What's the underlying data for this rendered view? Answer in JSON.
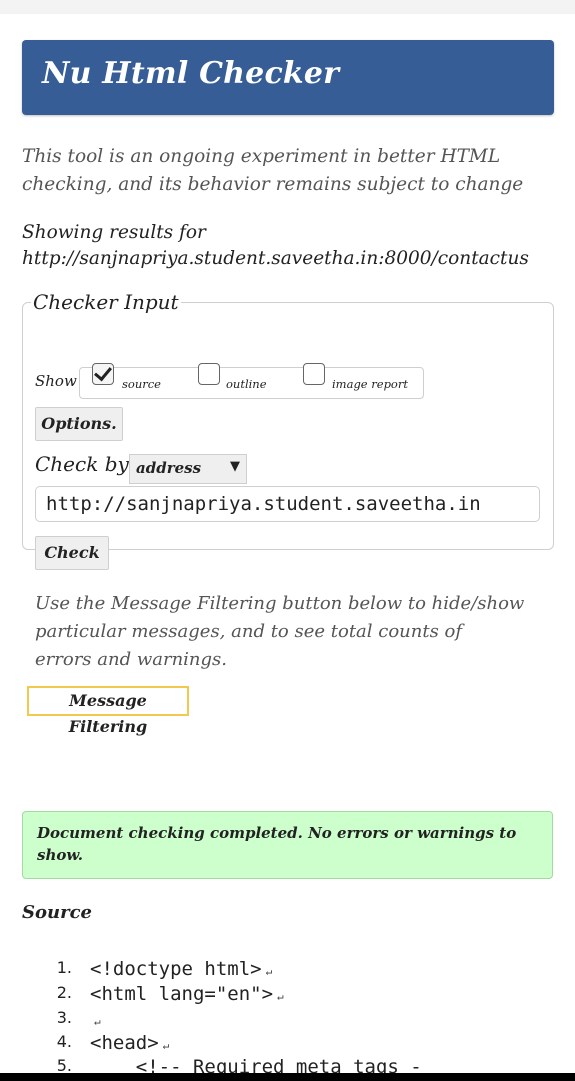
{
  "header": {
    "title": "Nu Html Checker"
  },
  "intro": {
    "line1": "This tool is an ongoing experiment in better HTML",
    "line2": "checking, and its behavior remains subject to change"
  },
  "showing": {
    "label": "Showing results for",
    "url": "http://sanjnapriya.student.saveetha.in:8000/contactus"
  },
  "checker": {
    "legend": "Checker Input",
    "show_label": "Show",
    "options": [
      {
        "label": "source",
        "checked": true
      },
      {
        "label": "outline",
        "checked": false
      },
      {
        "label": "image report",
        "checked": false
      }
    ],
    "options_button": "Options.",
    "check_by_label": "Check by",
    "check_by_value": "address",
    "url_value": "http://sanjnapriya.student.saveetha.in",
    "check_button": "Check"
  },
  "filter": {
    "line1": "Use the Message Filtering button below to hide/show",
    "line2": "particular messages, and to see total counts of",
    "line3": "errors and warnings.",
    "button": "Message Filtering"
  },
  "result": {
    "line1": "Document checking completed. No errors or warnings to",
    "line2": "show."
  },
  "source": {
    "heading": "Source",
    "lines": [
      {
        "num": "1.",
        "text": "<!doctype html>"
      },
      {
        "num": "2.",
        "text": "<html lang=\"en\">"
      },
      {
        "num": "3.",
        "text": ""
      },
      {
        "num": "4.",
        "text": "<head>"
      },
      {
        "num": "5.",
        "text": "    <!-- Required meta tags -"
      }
    ]
  }
}
